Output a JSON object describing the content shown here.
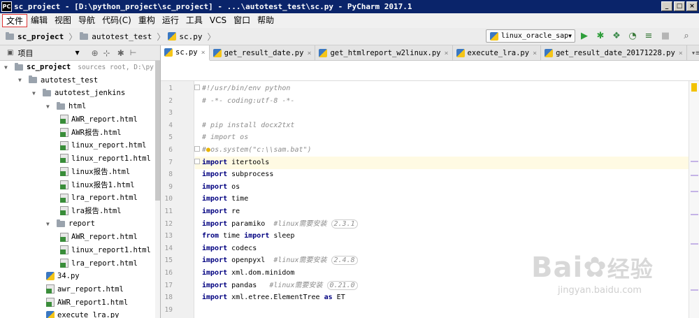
{
  "window": {
    "title": "sc_project - [D:\\python_project\\sc_project] - ...\\autotest_test\\sc.py - PyCharm 2017.1",
    "app_icon": "PC",
    "buttons": [
      "_",
      "□",
      "×"
    ]
  },
  "menubar": {
    "items": [
      "文件",
      "编辑",
      "视图",
      "导航",
      "代码(C)",
      "重构",
      "运行",
      "工具",
      "VCS",
      "窗口",
      "帮助"
    ]
  },
  "navbar": {
    "breadcrumbs": [
      "sc_project",
      "autotest_test",
      "sc.py"
    ],
    "run_config": "linux_oracle_sap"
  },
  "project_panel": {
    "header": "项目",
    "tree": [
      {
        "label": "sc_project",
        "hint": "sources root,  D:\\py",
        "depth": 0,
        "type": "folder",
        "expanded": true
      },
      {
        "label": "autotest_test",
        "depth": 1,
        "type": "folder",
        "expanded": true
      },
      {
        "label": "autotest_jenkins",
        "depth": 2,
        "type": "folder",
        "expanded": true
      },
      {
        "label": "html",
        "depth": 3,
        "type": "folder",
        "expanded": true
      },
      {
        "label": "AWR_report.html",
        "depth": 4,
        "type": "html"
      },
      {
        "label": "AWR报告.html",
        "depth": 4,
        "type": "html"
      },
      {
        "label": "linux_report.html",
        "depth": 4,
        "type": "html"
      },
      {
        "label": "linux_report1.html",
        "depth": 4,
        "type": "html"
      },
      {
        "label": "linux报告.html",
        "depth": 4,
        "type": "html"
      },
      {
        "label": "linux报告1.html",
        "depth": 4,
        "type": "html"
      },
      {
        "label": "lra_report.html",
        "depth": 4,
        "type": "html"
      },
      {
        "label": "lra报告.html",
        "depth": 4,
        "type": "html"
      },
      {
        "label": "report",
        "depth": 3,
        "type": "folder",
        "expanded": true
      },
      {
        "label": "AWR_report.html",
        "depth": 4,
        "type": "html"
      },
      {
        "label": "linux_report1.html",
        "depth": 4,
        "type": "html"
      },
      {
        "label": "lra_report.html",
        "depth": 4,
        "type": "html"
      },
      {
        "label": "34.py",
        "depth": 3,
        "type": "py"
      },
      {
        "label": "awr_report.html",
        "depth": 3,
        "type": "html"
      },
      {
        "label": "AWR_report1.html",
        "depth": 3,
        "type": "html"
      },
      {
        "label": "execute_lra.py",
        "depth": 3,
        "type": "py"
      }
    ]
  },
  "tabs": [
    {
      "label": "sc.py",
      "active": true
    },
    {
      "label": "get_result_date.py",
      "active": false
    },
    {
      "label": "get_htmlreport_w2linux.py",
      "active": false
    },
    {
      "label": "execute_lra.py",
      "active": false
    },
    {
      "label": "get_result_date_20171228.py",
      "active": false
    }
  ],
  "tabs_more": "▾≡4",
  "editor": {
    "current_line": 7,
    "lines": [
      {
        "n": "1",
        "text": "#!/usr/bin/env python"
      },
      {
        "n": "2",
        "text": "# -*- coding:utf-8 -*-"
      },
      {
        "n": "3",
        "text": ""
      },
      {
        "n": "4",
        "text": "# pip install docx2txt"
      },
      {
        "n": "5",
        "text": "# import os"
      },
      {
        "n": "6",
        "text": "#os.system(\"c:\\\\sam.bat\")"
      },
      {
        "n": "7",
        "text": "import itertools"
      },
      {
        "n": "8",
        "text": "import subprocess"
      },
      {
        "n": "9",
        "text": "import os"
      },
      {
        "n": "10",
        "text": "import time"
      },
      {
        "n": "11",
        "text": "import re"
      },
      {
        "n": "12",
        "text": "import paramiko  #linux需要安装 (2.3.1)"
      },
      {
        "n": "13",
        "text": "from time import sleep"
      },
      {
        "n": "14",
        "text": "import codecs"
      },
      {
        "n": "15",
        "text": "import openpyxl  #linux需要安装 (2.4.8)"
      },
      {
        "n": "16",
        "text": "import xml.dom.minidom"
      },
      {
        "n": "17",
        "text": "import pandas   #linux需要安装 (0.21.0)"
      },
      {
        "n": "18",
        "text": "import xml.etree.ElementTree as ET"
      },
      {
        "n": "19",
        "text": ""
      }
    ]
  },
  "watermark": {
    "brand": "Bai",
    "brand_cn": "经验",
    "url": "jingyan.baidu.com"
  }
}
